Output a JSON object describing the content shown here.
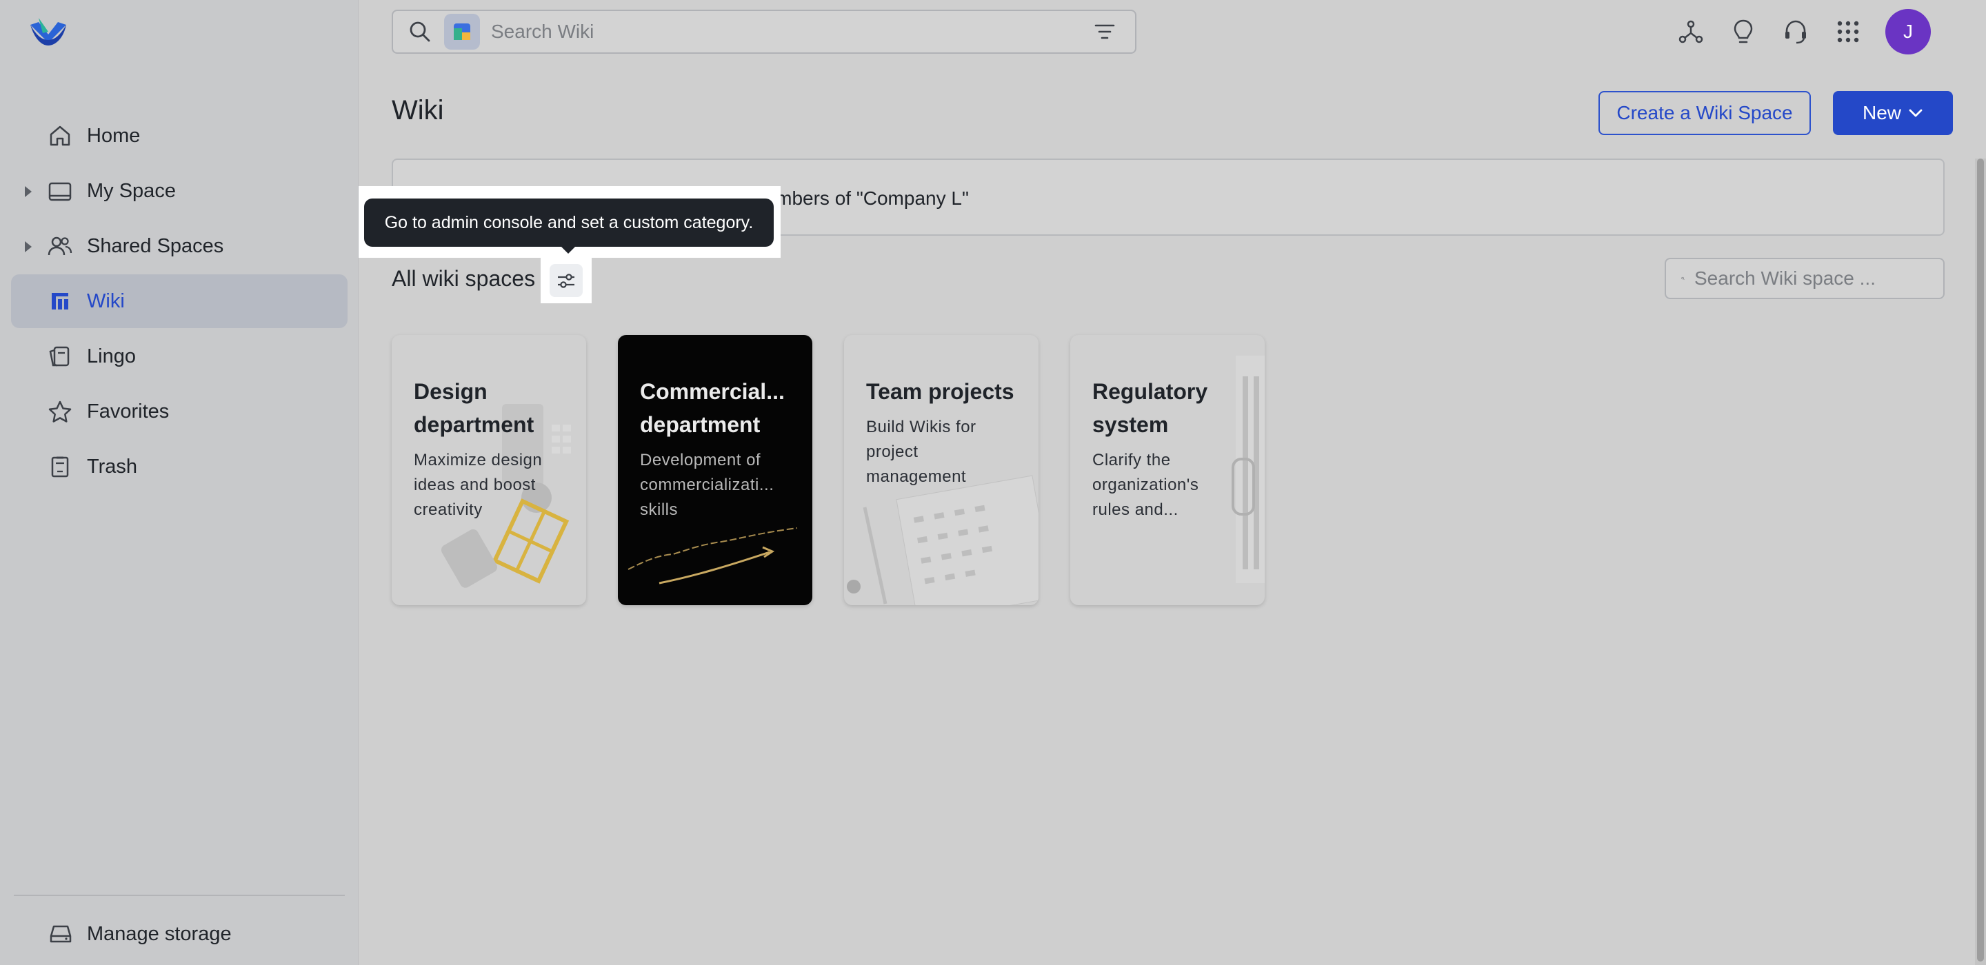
{
  "sidebar": {
    "items": [
      {
        "label": "Home",
        "icon": "home-icon"
      },
      {
        "label": "My Space",
        "icon": "folder-icon",
        "expandable": true
      },
      {
        "label": "Shared Spaces",
        "icon": "people-icon",
        "expandable": true
      },
      {
        "label": "Wiki",
        "icon": "wiki-icon",
        "active": true
      },
      {
        "label": "Lingo",
        "icon": "lingo-icon"
      },
      {
        "label": "Favorites",
        "icon": "star-icon"
      },
      {
        "label": "Trash",
        "icon": "trash-icon"
      }
    ],
    "manage_storage": "Manage storage"
  },
  "topbar": {
    "search_placeholder": "Search Wiki",
    "avatar_initial": "J"
  },
  "page": {
    "title": "Wiki",
    "create_label": "Create a Wiki Space",
    "new_label": "New"
  },
  "announcement": {
    "text": "This announcement is visible to all members of \"Company L\""
  },
  "tooltip": {
    "text": "Go to admin console and set a custom category."
  },
  "spaces": {
    "section_title": "All wiki spaces",
    "search_placeholder": "Search Wiki space ...",
    "cards": [
      {
        "title": "Design department",
        "desc": "Maximize design ideas and boost creativity",
        "theme": "light"
      },
      {
        "title": "Commercial... department",
        "desc": "Development of commercializati... skills",
        "theme": "dark"
      },
      {
        "title": "Team projects",
        "desc": "Build Wikis for project management",
        "theme": "light"
      },
      {
        "title": "Regulatory system",
        "desc": "Clarify the organization's rules and...",
        "theme": "light"
      }
    ]
  },
  "colors": {
    "accent": "#2448c8",
    "avatar": "#6a34c3",
    "tooltip_bg": "#1f2329"
  }
}
